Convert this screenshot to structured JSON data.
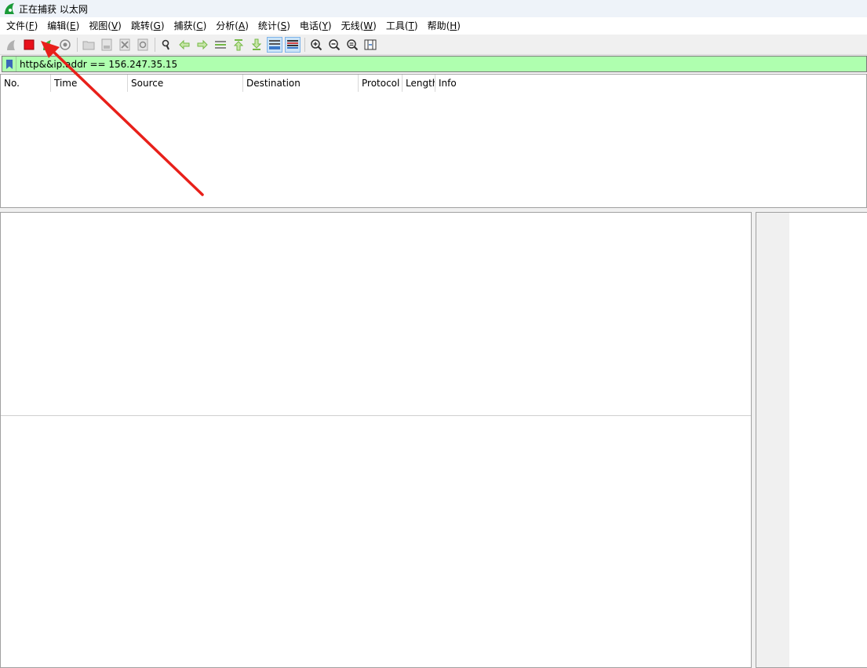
{
  "window": {
    "title": "正在捕获 以太网"
  },
  "menu": [
    {
      "label": "文件(",
      "accel": "F",
      "tail": ")"
    },
    {
      "label": "编辑(",
      "accel": "E",
      "tail": ")"
    },
    {
      "label": "视图(",
      "accel": "V",
      "tail": ")"
    },
    {
      "label": "跳转(",
      "accel": "G",
      "tail": ")"
    },
    {
      "label": "捕获(",
      "accel": "C",
      "tail": ")"
    },
    {
      "label": "分析(",
      "accel": "A",
      "tail": ")"
    },
    {
      "label": "统计(",
      "accel": "S",
      "tail": ")"
    },
    {
      "label": "电话(",
      "accel": "Y",
      "tail": ")"
    },
    {
      "label": "无线(",
      "accel": "W",
      "tail": ")"
    },
    {
      "label": "工具(",
      "accel": "T",
      "tail": ")"
    },
    {
      "label": "帮助(",
      "accel": "H",
      "tail": ")"
    }
  ],
  "toolbar": {
    "icons": [
      "start-capture-icon",
      "stop-capture-icon",
      "restart-capture-icon",
      "capture-options-icon",
      "open-file-icon",
      "save-file-icon",
      "close-file-icon",
      "reload-file-icon",
      "find-packet-icon",
      "go-back-icon",
      "go-forward-icon",
      "go-to-packet-icon",
      "first-packet-icon",
      "last-packet-icon",
      "autoscroll-icon",
      "colorize-icon",
      "zoom-in-icon",
      "zoom-out-icon",
      "normal-size-icon",
      "resize-columns-icon"
    ],
    "colors": {
      "stop": "#e8101a",
      "restart": "#3ab03a",
      "arrows": "#74b845",
      "active": "#cce4f7"
    }
  },
  "filter": {
    "value": "http&&ip.addr == 156.247.35.15",
    "background": "#afffaf"
  },
  "packet_list": {
    "columns": [
      "No.",
      "Time",
      "Source",
      "Destination",
      "Protocol",
      "Length",
      "Info"
    ]
  },
  "annotation": {
    "color": "#e8201a"
  }
}
